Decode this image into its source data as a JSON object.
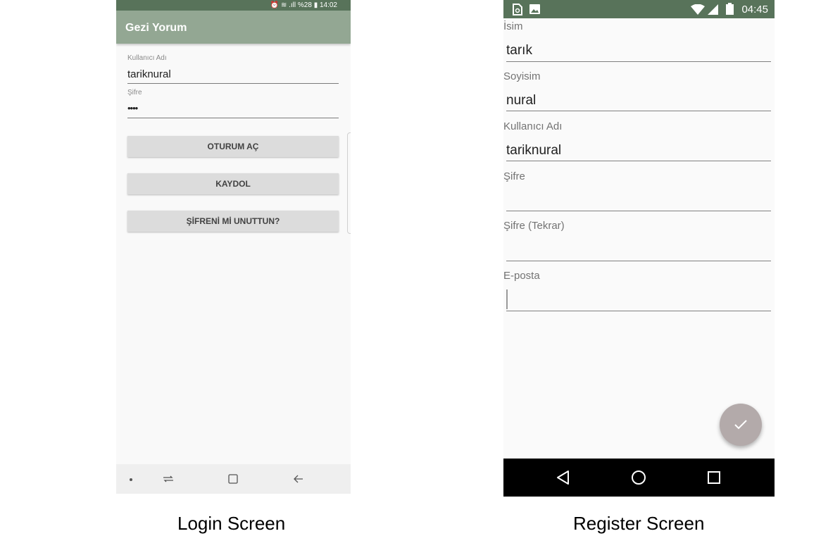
{
  "login": {
    "status_text": "⏰ ≋ .ıll %28 ▮ 14:02",
    "app_title": "Gezi Yorum",
    "username_label": "Kullanıcı Adı",
    "username_value": "tariknural",
    "password_label": "Şifre",
    "password_value": "••••",
    "login_button": "OTURUM AÇ",
    "register_button": "KAYDOL",
    "forgot_button": "ŞİFRENİ Mİ UNUTTUN?",
    "caption": "Login Screen"
  },
  "register": {
    "status_time": "04:45",
    "name_label": "İsim",
    "name_value": "tarık",
    "surname_label": "Soyisim",
    "surname_value": "nural",
    "username_label": "Kullanıcı Adı",
    "username_value": "tariknural",
    "password_label": "Şifre",
    "password_value": "",
    "password_repeat_label": "Şifre (Tekrar)",
    "password_repeat_value": "",
    "email_label": "E-posta",
    "email_value": "",
    "caption": "Register Screen"
  },
  "colors": {
    "status_bar": "#58735a",
    "app_bar": "#93a793",
    "fab": "#b3aaaa",
    "button": "#dcdcdc"
  },
  "icons": [
    "alarm-icon",
    "wifi-icon",
    "signal-icon",
    "battery-icon",
    "dot-icon",
    "recent-apps-icon",
    "overview-icon",
    "back-arrow-icon",
    "sim-icon",
    "image-icon",
    "check-icon",
    "back-triangle-icon",
    "home-circle-icon",
    "recents-square-icon"
  ]
}
